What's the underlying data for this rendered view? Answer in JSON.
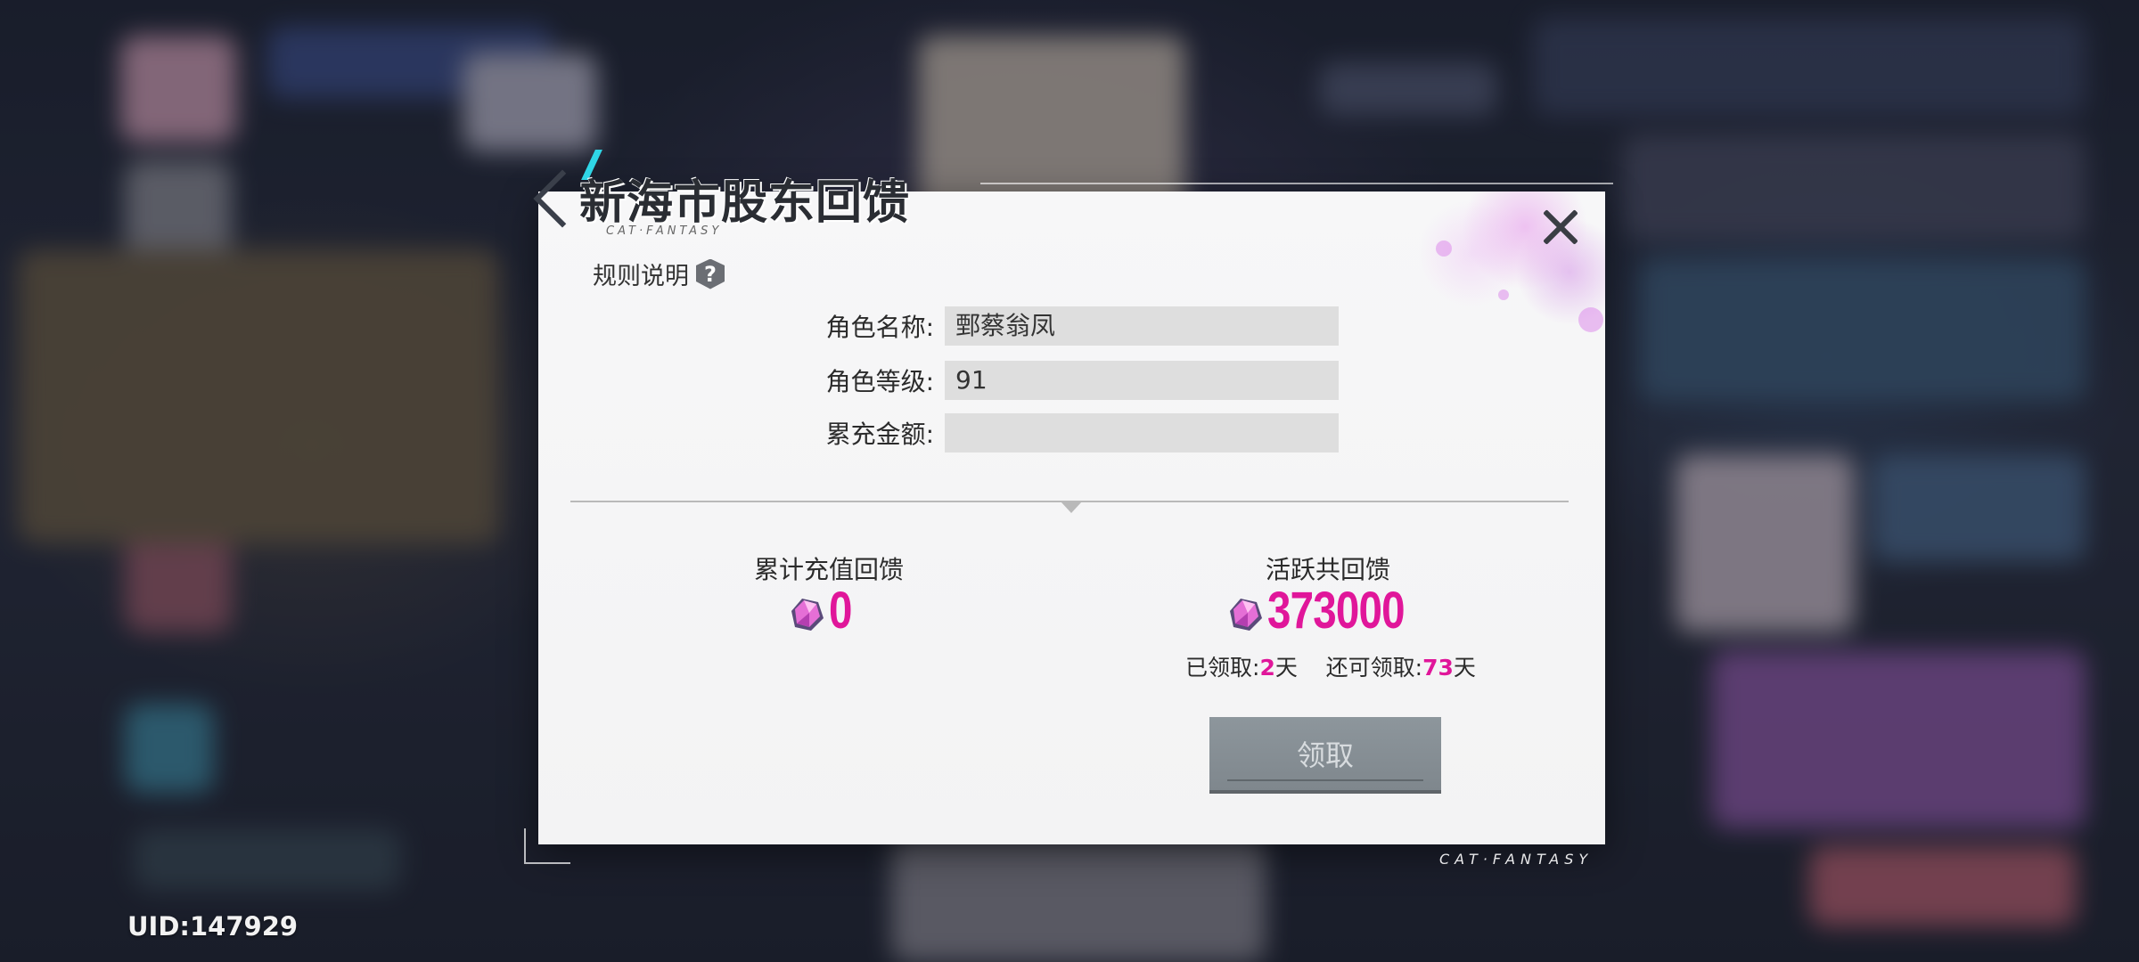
{
  "dialog": {
    "title": "新海市股东回馈",
    "title_sub": "CAT·FANTASY",
    "rules_label": "规则说明",
    "rules_icon": "?"
  },
  "form": {
    "role_name_label": "角色名称:",
    "role_name_value": "鄄蔡翁凤",
    "role_level_label": "角色等级:",
    "role_level_value": "91",
    "recharge_label": "累充金额:",
    "recharge_value": ""
  },
  "rewards": {
    "recharge_label": "累计充值回馈",
    "recharge_amount": "0",
    "active_label": "活跃共回馈",
    "active_amount": "373000",
    "claimed_label": "已领取:",
    "claimed_days": "2",
    "claimed_unit": "天",
    "remaining_label": "还可领取:",
    "remaining_days": "73",
    "remaining_unit": "天",
    "claim_button": "领取"
  },
  "footer": {
    "brand": "CAT·FANTASY",
    "uid": "UID:147929"
  },
  "colors": {
    "accent": "#e0169a",
    "button": "#868e94"
  }
}
